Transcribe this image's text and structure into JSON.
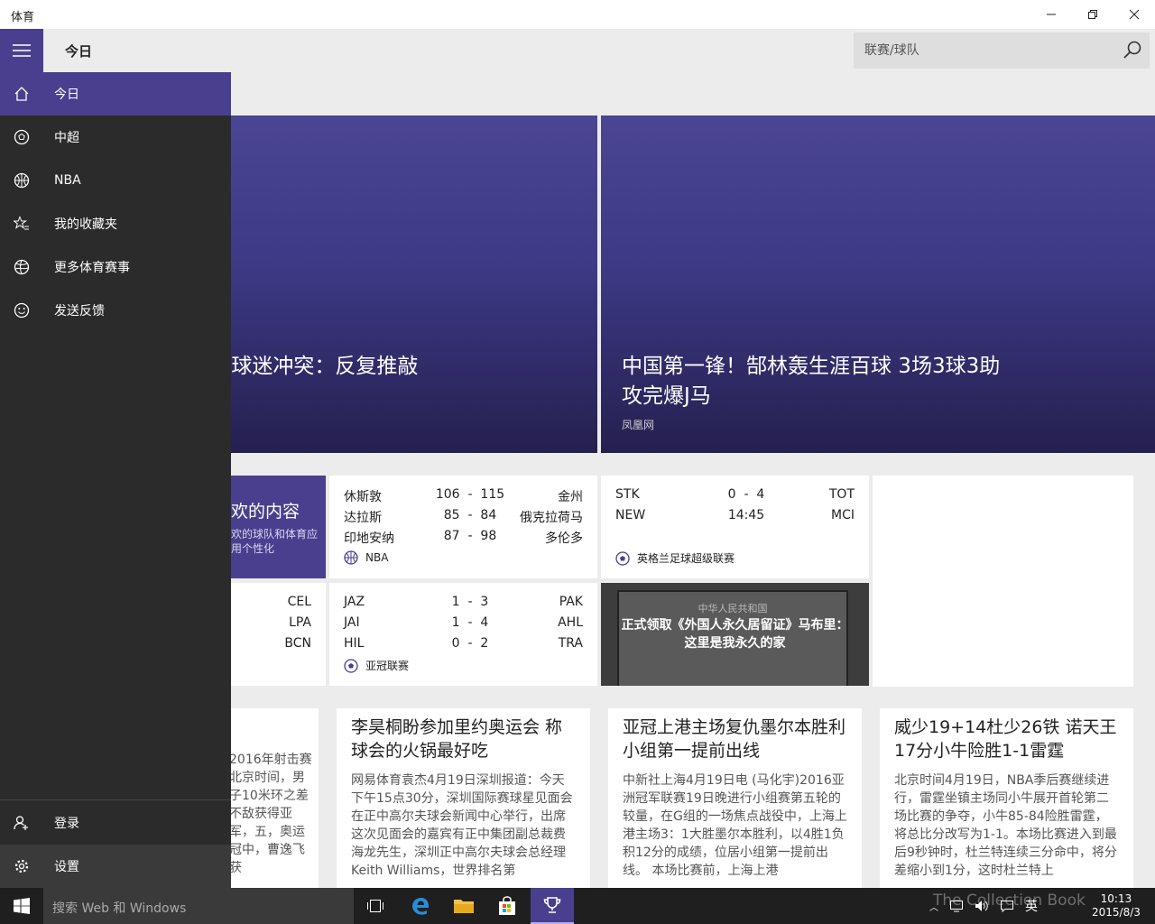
{
  "window": {
    "title": "体育"
  },
  "header": {
    "page_title": "今日",
    "search_placeholder": "联赛/球队"
  },
  "nav": {
    "items": [
      {
        "label": "今日",
        "icon": "home-icon"
      },
      {
        "label": "中超",
        "icon": "soccer-ball-icon"
      },
      {
        "label": "NBA",
        "icon": "basketball-icon"
      },
      {
        "label": "我的收藏夹",
        "icon": "star-list-icon"
      },
      {
        "label": "更多体育赛事",
        "icon": "sports-ball-icon"
      },
      {
        "label": "发送反馈",
        "icon": "smiley-icon"
      }
    ],
    "bottom": [
      {
        "label": "登录",
        "icon": "user-add-icon"
      },
      {
        "label": "设置",
        "icon": "gear-icon"
      }
    ]
  },
  "heroes": [
    {
      "headline": "l球迷冲突：反复推敲"
    },
    {
      "headline": "中国第一锋！郜林轰生涯百球 3场3球3助攻完爆J马",
      "source": "凤凰网"
    }
  ],
  "personalize": {
    "title": "欢的内容",
    "body": "欢的球队和体育应用个性化"
  },
  "nba": {
    "league": "NBA",
    "rows": [
      {
        "home": "休斯敦",
        "score": "106  -  115",
        "away": "金州"
      },
      {
        "home": "达拉斯",
        "score": "85  -  84",
        "away": "俄克拉荷马"
      },
      {
        "home": "印地安纳",
        "score": "87  -  98",
        "away": "多伦多"
      }
    ]
  },
  "epl": {
    "league": "英格兰足球超级联赛",
    "rows": [
      {
        "home": "STK",
        "score": "0  -  4",
        "away": "TOT"
      },
      {
        "home": "NEW",
        "score": "14:45",
        "away": "MCI"
      }
    ]
  },
  "partial": {
    "rows": [
      "CEL",
      "LPA",
      "BCN"
    ]
  },
  "afc": {
    "league": "亚冠联赛",
    "rows": [
      {
        "home": "JAZ",
        "score": "1  -  3",
        "away": "PAK"
      },
      {
        "home": "JAI",
        "score": "1  -  4",
        "away": "AHL"
      },
      {
        "home": "HIL",
        "score": "0  -  2",
        "away": "TRA"
      }
    ]
  },
  "photo": {
    "caption": "正式领取《外国人永久居留证》马布里：这里是我永久的家",
    "card_text": "中华人民共和国"
  },
  "news": [
    {
      "body": "2016年射击赛北京时间，男子10米环之差不敌获得亚军，五，奥运冠中，曹逸飞获"
    },
    {
      "headline": "李昊桐盼参加里约奥运会 称球会的火锅最好吃",
      "body": "网易体育袁杰4月19日深圳报道：今天下午15点30分，深圳国际赛球星见面会在正中高尔夫球会新闻中心举行，出席这次见面会的嘉宾有正中集团副总裁费海龙先生，深圳正中高尔夫球会总经理Keith Williams，世界排名第"
    },
    {
      "headline": "亚冠上港主场复仇墨尔本胜利 小组第一提前出线",
      "body": "中新社上海4月19日电 (马化宇)2016亚洲冠军联赛19日晚进行小组赛第五轮的较量，在G组的一场焦点战役中，上海上港主场3：1大胜墨尔本胜利，以4胜1负积12分的成绩，位居小组第一提前出线。 本场比赛前，上海上港"
    },
    {
      "headline": "威少19+14杜少26铁 诺天王17分小牛险胜1-1雷霆",
      "body": "北京时间4月19日，NBA季后赛继续进行，雷霆坐镇主场同小牛展开首轮第二场比赛的争夺，小牛85-84险胜雷霆，将总比分改写为1-1。本场比赛进入到最后9秒钟时，杜兰特连续三分命中，将分差缩小到1分，这时杜兰特上"
    }
  ],
  "taskbar": {
    "search_placeholder": "搜索 Web 和 Windows",
    "time": "10:13",
    "date": "2015/8/3",
    "ime": "英",
    "watermark": "The Collection Book"
  }
}
